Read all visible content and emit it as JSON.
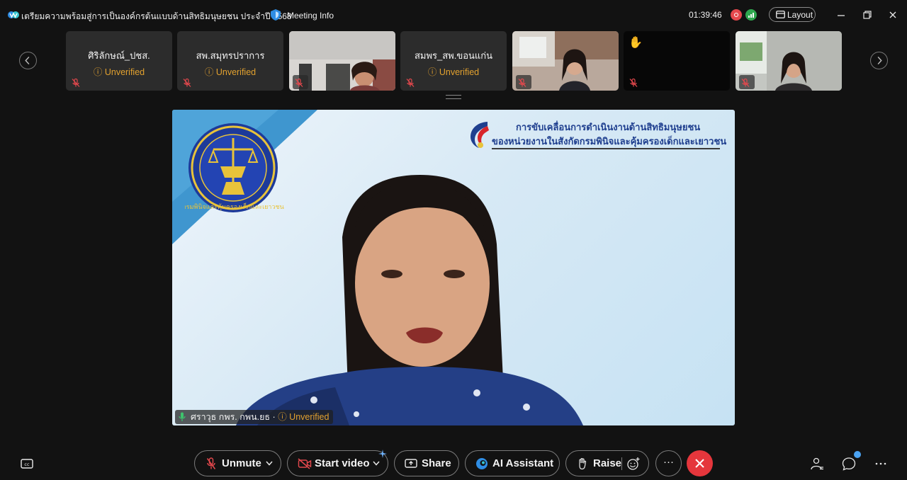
{
  "titlebar": {
    "meeting_title": "เตรียมความพร้อมสู่การเป็นองค์กรต้นแบบด้านสิทธิมนุษยชน ประจำปี 2568",
    "meeting_info_label": "Meeting Info",
    "clock": "01:39:46",
    "layout_label": "Layout"
  },
  "participants": [
    {
      "name": "ศิริลักษณ์_ปชส.",
      "status": "Unverified",
      "video": false,
      "muted": true
    },
    {
      "name": "สพ.สมุทรปราการ",
      "status": "Unverified",
      "video": false,
      "muted": true
    },
    {
      "name": "",
      "status": "",
      "video": true,
      "muted": true
    },
    {
      "name": "สมพร_สพ.ขอนแก่น",
      "status": "Unverified",
      "video": false,
      "muted": true
    },
    {
      "name": "",
      "status": "",
      "video": true,
      "muted": true
    },
    {
      "name": "",
      "status": "",
      "video": true,
      "muted": true,
      "hand_raised": true
    },
    {
      "name": "",
      "status": "",
      "video": true,
      "muted": true
    }
  ],
  "slide": {
    "title_line1": "การขับเคลื่อนการดำเนินงานด้านสิทธิมนุษยชน",
    "title_line2": "ของหน่วยงานในสังกัดกรมพินิจและคุ้มครองเด็กและเยาวชน",
    "seal_text": "กรมพินิจและคุ้มครองเด็กและเยาวชน"
  },
  "active_speaker": {
    "name": "ศราวุธ กพร. กพน.ยธ",
    "separator": "·",
    "status": "Unverified"
  },
  "controls": {
    "unmute": "Unmute",
    "start_video": "Start video",
    "share": "Share",
    "ai_assistant": "AI Assistant",
    "raise": "Raise",
    "more": "···"
  },
  "colors": {
    "background": "#121212",
    "tile": "#2c2c2c",
    "unverified": "#e2a12f",
    "leave": "#e5363c",
    "muted_icon": "#e5484d",
    "badge": "#4ba3f2"
  }
}
